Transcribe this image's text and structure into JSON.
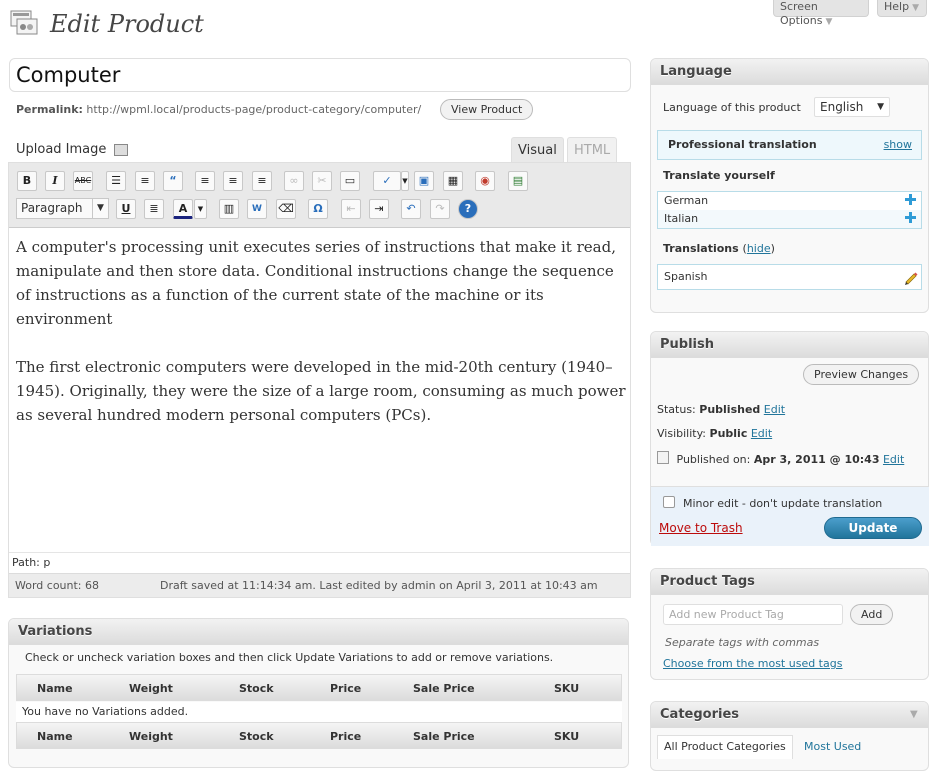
{
  "header": {
    "title": "Edit Product",
    "screen_options": "Screen Options",
    "help": "Help"
  },
  "post": {
    "title": "Computer",
    "permalink_label": "Permalink:",
    "permalink_url": "http://wpml.local/products-page/product-category/computer/",
    "view_button": "View Product"
  },
  "editor": {
    "upload_label": "Upload Image",
    "tab_visual": "Visual",
    "tab_html": "HTML",
    "format_select": "Paragraph",
    "paragraphs": [
      "A computer's processing unit executes series of instructions that make it read, manipulate and then store data. Conditional instructions change the sequence of instructions as a function of the current state of the machine or its environment",
      "The first electronic computers were developed in the mid-20th century (1940–1945). Originally, they were the size of a large room, consuming as much power as several hundred modern personal computers (PCs)."
    ],
    "path": "Path: p",
    "word_count": "Word count: 68",
    "draft_status": "Draft saved at 11:14:34 am. Last edited by admin on April 3, 2011 at 10:43 am"
  },
  "variations": {
    "title": "Variations",
    "description": "Check or uncheck variation boxes and then click Update Variations to add or remove variations.",
    "columns": [
      "Name",
      "Weight",
      "Stock",
      "Price",
      "Sale Price",
      "SKU"
    ],
    "empty": "You have no Variations added."
  },
  "language": {
    "title": "Language",
    "label": "Language of this product",
    "selected": "English",
    "professional": "Professional translation",
    "show": "show",
    "translate_yourself": "Translate yourself",
    "translate_langs": [
      "German",
      "Italian"
    ],
    "translations_label": "Translations",
    "hide": "hide",
    "translations": [
      "Spanish"
    ]
  },
  "publish": {
    "title": "Publish",
    "preview": "Preview Changes",
    "status_label": "Status:",
    "status_value": "Published",
    "visibility_label": "Visibility:",
    "visibility_value": "Public",
    "published_label": "Published on:",
    "published_value": "Apr 3, 2011 @ 10:43",
    "edit": "Edit",
    "minor_edit": "Minor edit - don't update translation",
    "trash": "Move to Trash",
    "update": "Update"
  },
  "tags": {
    "title": "Product Tags",
    "placeholder": "Add new Product Tag",
    "add": "Add",
    "hint": "Separate tags with commas",
    "most_used": "Choose from the most used tags"
  },
  "categories": {
    "title": "Categories",
    "tab_all": "All Product Categories",
    "tab_most_used": "Most Used"
  }
}
